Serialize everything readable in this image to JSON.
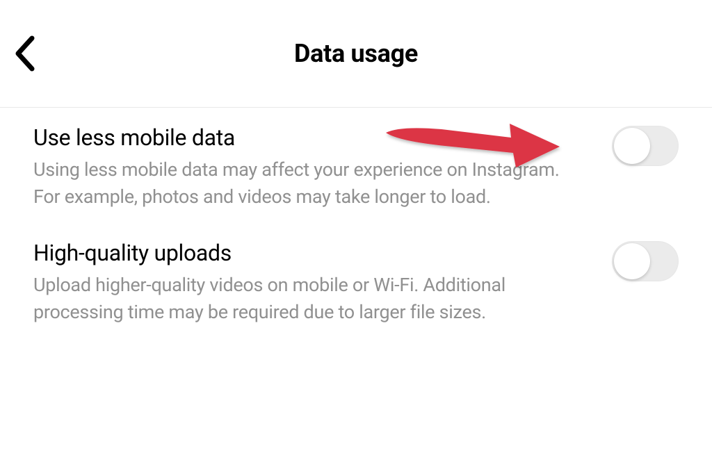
{
  "header": {
    "title": "Data usage"
  },
  "settings": [
    {
      "title": "Use less mobile data",
      "description": "Using less mobile data may affect your experience on Instagram. For example, photos and videos may take longer to load.",
      "enabled": false
    },
    {
      "title": "High-quality uploads",
      "description": "Upload higher-quality videos on mobile or Wi-Fi. Additional processing time may be required due to larger file sizes.",
      "enabled": false
    }
  ],
  "annotation": {
    "arrow_color": "#DC3545"
  }
}
